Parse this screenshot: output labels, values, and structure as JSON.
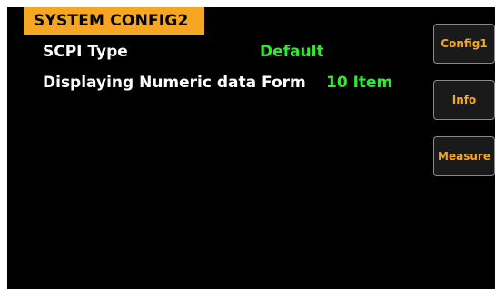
{
  "title": "SYSTEM  CONFIG2",
  "settings": [
    {
      "label": "SCPI Type",
      "value": "Default"
    },
    {
      "label": "Displaying Numeric data Form",
      "value": "10 Item"
    }
  ],
  "side_buttons": [
    "Config1",
    "Info",
    "Measure"
  ],
  "colors": {
    "background": "#000000",
    "title_bar": "#f5a623",
    "label_text": "#ffffff",
    "value_text": "#33e833",
    "button_text": "#f5a623",
    "button_border": "#8a8a8a"
  }
}
